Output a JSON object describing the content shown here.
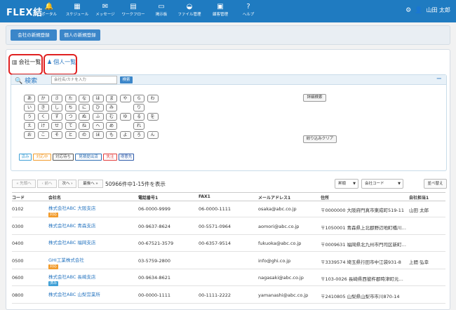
{
  "app": {
    "logo": "FLEX結"
  },
  "nav": [
    {
      "label": "ポータル",
      "icon": "bell-icon",
      "glyph": "🔔"
    },
    {
      "label": "スケジュール",
      "icon": "calendar-icon",
      "glyph": "▦"
    },
    {
      "label": "メッセージ",
      "icon": "mail-icon",
      "glyph": "✉"
    },
    {
      "label": "ワークフロー",
      "icon": "workflow-icon",
      "glyph": "▤"
    },
    {
      "label": "掲示板",
      "icon": "board-icon",
      "glyph": "▭"
    },
    {
      "label": "ファイル管理",
      "icon": "folder-icon",
      "glyph": "◒"
    },
    {
      "label": "顧客管理",
      "icon": "building-icon",
      "glyph": "▣"
    },
    {
      "label": "ヘルプ",
      "icon": "help-icon",
      "glyph": "?"
    }
  ],
  "user": {
    "name": "山田 太郎",
    "settings_icon": "gear-icon",
    "avatar_icon": "user-icon"
  },
  "register": {
    "company": "会社の新規登録",
    "person": "個人の新規登録"
  },
  "tabs": {
    "company": "会社一覧",
    "person": "個人一覧"
  },
  "search": {
    "title": "検索",
    "placeholder": "会社名/カナを入力",
    "button": "検索",
    "collapse": "−",
    "detail": "詳細検索",
    "clear": "絞り込みクリア",
    "kana_rows": [
      [
        "あ",
        "か",
        "さ",
        "た",
        "な",
        "は",
        "ま",
        "や",
        "ら",
        "わ"
      ],
      [
        "い",
        "き",
        "し",
        "ち",
        "に",
        "ひ",
        "み",
        "",
        "り",
        ""
      ],
      [
        "う",
        "く",
        "す",
        "つ",
        "ぬ",
        "ふ",
        "む",
        "ゆ",
        "る",
        "を"
      ],
      [
        "え",
        "け",
        "せ",
        "て",
        "ね",
        "へ",
        "め",
        "",
        "れ",
        ""
      ],
      [
        "お",
        "こ",
        "そ",
        "と",
        "の",
        "ほ",
        "も",
        "よ",
        "ろ",
        "ん"
      ]
    ],
    "statuses": [
      {
        "label": "済み",
        "color": "#3fa0d6"
      },
      {
        "label": "対応中",
        "color": "#f29b2b"
      },
      {
        "label": "対応待ち",
        "color": "#555555"
      },
      {
        "label": "見積提出済",
        "color": "#2f6fb3"
      },
      {
        "label": "失注",
        "color": "#e23a3a"
      },
      {
        "label": "得意先",
        "color": "#2b58a8"
      }
    ]
  },
  "pager": {
    "first": "« 先頭へ",
    "prev": "‹ 前へ",
    "next": "次へ ›",
    "last": "最後へ »",
    "count": "50966件中1-15件を表示",
    "order": "昇順",
    "sort_key": "会社コード",
    "sort_button": "並べ替え"
  },
  "table": {
    "columns": [
      "コード",
      "会社名",
      "電話番号1",
      "FAX1",
      "メールアドレス1",
      "住所",
      "自社担当1"
    ],
    "rows": [
      {
        "code": "0102",
        "name": "株式会社ABC 大阪支店",
        "badge": "対応",
        "badge_color": "#f29b2b",
        "tel": "06-0000-9999",
        "fax": "06-0000-1111",
        "mail": "osaka@abc.co.jp",
        "addr": "〒0000000 大阪府門真市東成町519-11",
        "rep": "山田 太郎"
      },
      {
        "code": "0300",
        "name": "株式会社ABC 青森支店",
        "badge": "",
        "badge_color": "",
        "tel": "00-9637-8624",
        "fax": "00-5571-0964",
        "mail": "aomori@abc.co.jp",
        "addr": "〒1050001 青森県上北郡野辺地町橋川…",
        "rep": ""
      },
      {
        "code": "0400",
        "name": "株式会社ABC 福岡支店",
        "badge": "",
        "badge_color": "",
        "tel": "00-67521-3579",
        "fax": "00-6357-9514",
        "mail": "fukuoka@abc.co.jp",
        "addr": "〒0009631 福岡県北九州市門司区新町…",
        "rep": ""
      },
      {
        "code": "0500",
        "name": "GHI工業株式会社",
        "badge": "対応",
        "badge_color": "#f29b2b",
        "tel": "03-5759-2800",
        "fax": "",
        "mail": "info@ghi.co.jp",
        "addr": "〒3339574 埼玉県行田市中江袋931-8",
        "rep": "上間 弘幸"
      },
      {
        "code": "0600",
        "name": "株式会社ABC 長崎支店",
        "badge": "済み",
        "badge_color": "#3fa0d6",
        "tel": "00-9634-8621",
        "fax": "",
        "mail": "nagasaki@abc.co.jp",
        "addr": "〒103-0026 長崎県西彼杵郡時津町元…",
        "rep": ""
      },
      {
        "code": "0800",
        "name": "株式会社ABC 山梨営業所",
        "badge": "",
        "badge_color": "",
        "tel": "00-0000-1111",
        "fax": "00-1111-2222",
        "mail": "yamanashi@abc.co.jp",
        "addr": "〒2410805 山梨県山梨市市川870-14",
        "rep": ""
      }
    ]
  }
}
